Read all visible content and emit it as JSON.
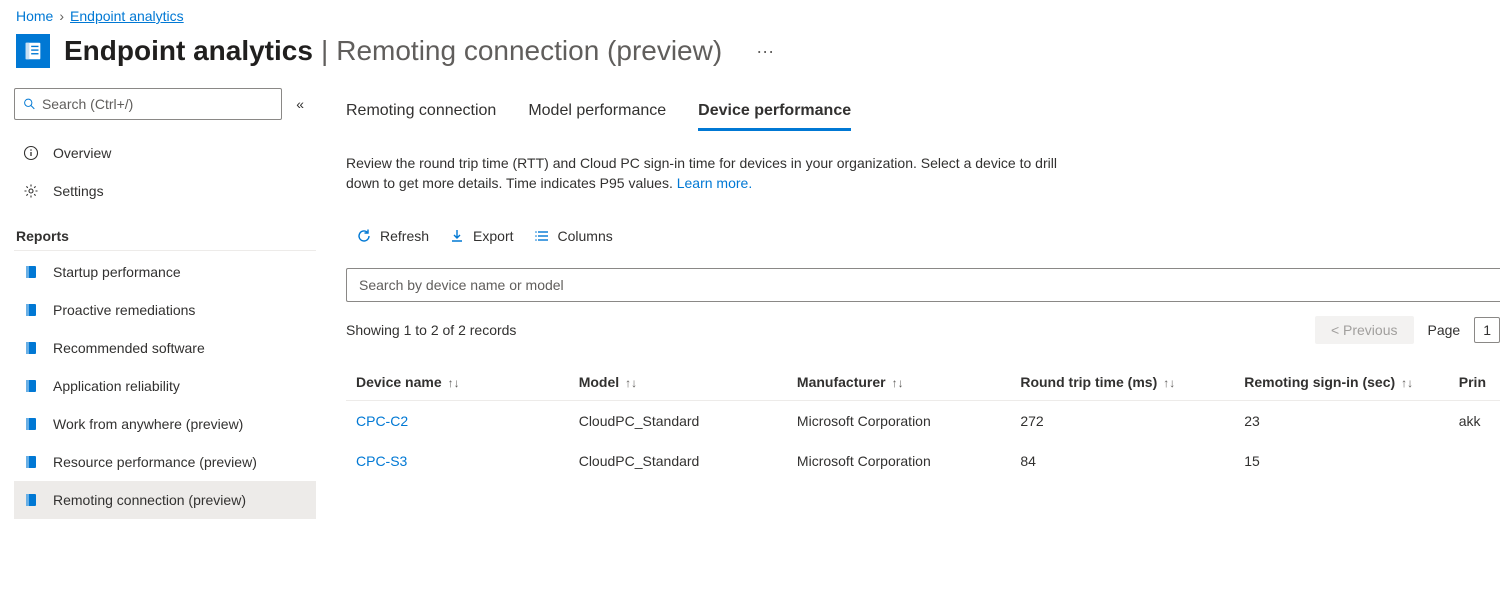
{
  "breadcrumb": {
    "home": "Home",
    "current": "Endpoint analytics"
  },
  "header": {
    "title": "Endpoint analytics",
    "subtitle": "Remoting connection (preview)"
  },
  "sidebar": {
    "search_placeholder": "Search (Ctrl+/)",
    "items_top": [
      {
        "label": "Overview"
      },
      {
        "label": "Settings"
      }
    ],
    "section_label": "Reports",
    "items_reports": [
      {
        "label": "Startup performance"
      },
      {
        "label": "Proactive remediations"
      },
      {
        "label": "Recommended software"
      },
      {
        "label": "Application reliability"
      },
      {
        "label": "Work from anywhere (preview)"
      },
      {
        "label": "Resource performance (preview)"
      },
      {
        "label": "Remoting connection (preview)"
      }
    ]
  },
  "tabs": [
    {
      "label": "Remoting connection"
    },
    {
      "label": "Model performance"
    },
    {
      "label": "Device performance"
    }
  ],
  "description": {
    "text": "Review the round trip time (RTT) and Cloud PC sign-in time for devices in your organization. Select a device to drill down to get more details. Time indicates P95 values. ",
    "link": "Learn more."
  },
  "toolbar": {
    "refresh": "Refresh",
    "export": "Export",
    "columns": "Columns"
  },
  "filter_placeholder": "Search by device name or model",
  "record_count": "Showing 1 to 2 of 2 records",
  "pager": {
    "prev": "<  Previous",
    "page_label": "Page",
    "page_num": "1"
  },
  "table": {
    "headers": {
      "device": "Device name",
      "model": "Model",
      "manufacturer": "Manufacturer",
      "rtt": "Round trip time (ms)",
      "signin": "Remoting sign-in (sec)",
      "primary": "Prin"
    },
    "rows": [
      {
        "device": "CPC-C2",
        "model": "CloudPC_Standard",
        "manufacturer": "Microsoft Corporation",
        "rtt": "272",
        "signin": "23",
        "primary": "akk"
      },
      {
        "device": "CPC-S3",
        "model": "CloudPC_Standard",
        "manufacturer": "Microsoft Corporation",
        "rtt": "84",
        "signin": "15",
        "primary": ""
      }
    ]
  }
}
